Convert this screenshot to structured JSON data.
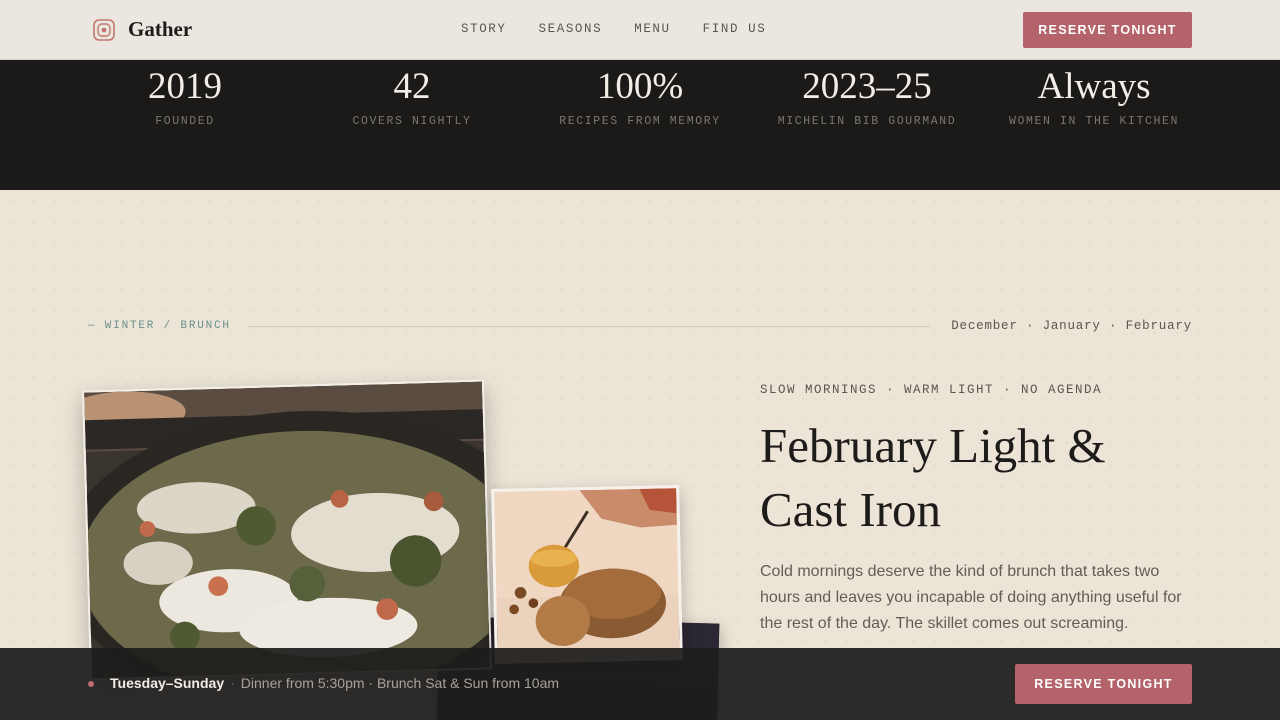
{
  "nav": {
    "brand": "Gather",
    "links": [
      "STORY",
      "SEASONS",
      "MENU",
      "FIND US"
    ],
    "cta": "RESERVE TONIGHT"
  },
  "stats": [
    {
      "value": "2019",
      "label": "FOUNDED"
    },
    {
      "value": "42",
      "label": "COVERS NIGHTLY"
    },
    {
      "value": "100%",
      "label": "RECIPES FROM MEMORY"
    },
    {
      "value": "2023–25",
      "label": "MICHELIN BIB GOURMAND"
    },
    {
      "value": "Always",
      "label": "WOMEN IN THE KITCHEN"
    }
  ],
  "season": {
    "tag": "— WINTER / BRUNCH",
    "months": "December · January · February",
    "kicker": "SLOW MORNINGS · WARM LIGHT · NO AGENDA",
    "headline": "February Light & Cast Iron",
    "lede": "Cold mornings deserve the kind of brunch that takes two hours and leaves you incapable of doing anything useful for the rest of the day. The skillet comes out screaming."
  },
  "bottom_bar": {
    "days": "Tuesday–Sunday",
    "separator": "·",
    "hours": "Dinner from 5:30pm · Brunch Sat & Sun from 10am",
    "cta": "RESERVE TONIGHT"
  },
  "colors": {
    "accent": "#b5636b",
    "dark_band": "#1b1a19",
    "cream": "#ece4d6",
    "teal_tag": "#6b8f8a"
  }
}
